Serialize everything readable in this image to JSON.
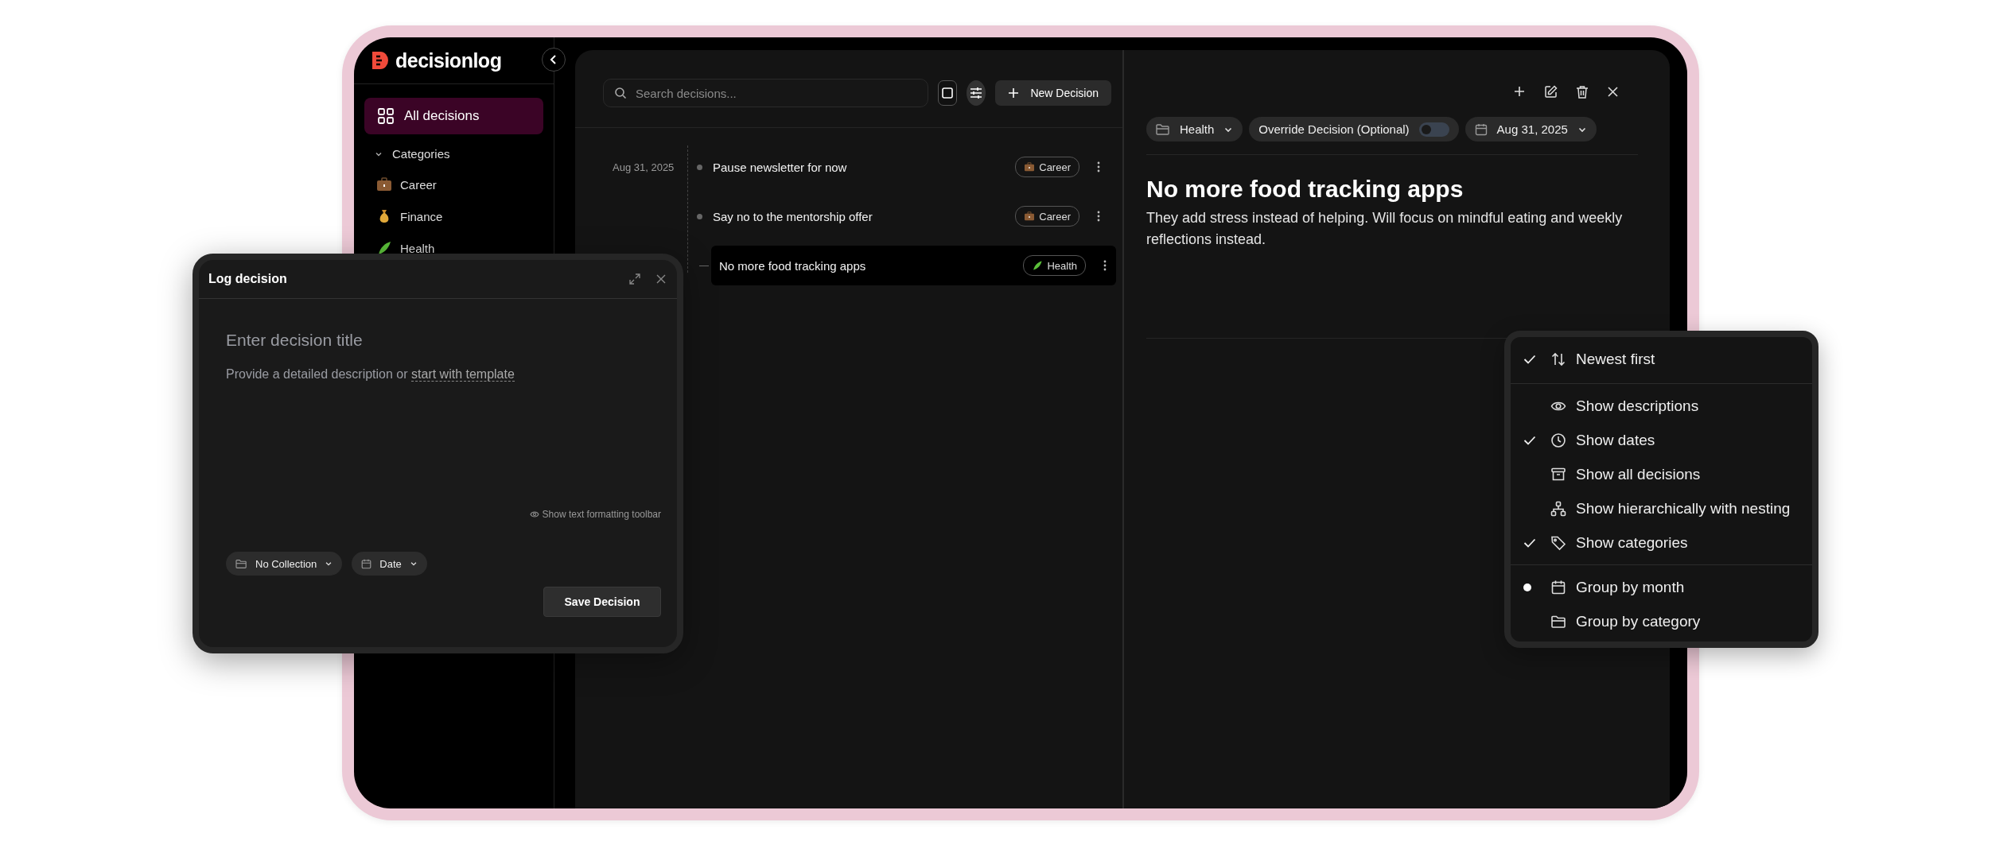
{
  "sidebar": {
    "logo": "decisionlog",
    "nav": [
      {
        "label": "All decisions",
        "selected": true
      }
    ],
    "categories_header": {
      "label": "Categories",
      "expanded": true
    },
    "categories": [
      {
        "label": "Career",
        "kind": "briefcase"
      },
      {
        "label": "Finance",
        "kind": "moneybag"
      },
      {
        "label": "Health",
        "kind": "leaf"
      }
    ]
  },
  "list": {
    "search": {
      "placeholder": "Search decisions..."
    },
    "new_button": "New Decision",
    "items": [
      {
        "date": "Aug 31, 2025",
        "title": "Pause newsletter for now",
        "tag": {
          "label": "Career",
          "kind": "briefcase"
        },
        "selected": false
      },
      {
        "title": "Say no to the mentorship offer",
        "tag": {
          "label": "Career",
          "kind": "briefcase"
        },
        "selected": false
      },
      {
        "title": "No more food tracking apps",
        "tag": {
          "label": "Health",
          "kind": "leaf"
        },
        "selected": true
      }
    ]
  },
  "detail": {
    "collection": "Health",
    "override": {
      "label": "Override Decision (Optional)",
      "on": false
    },
    "date": "Aug 31, 2025",
    "title": "No more food tracking apps",
    "description": "They add stress instead of helping. Will focus on mindful eating and weekly reflections instead."
  },
  "view_menu": {
    "sections": [
      [
        {
          "kind": "check",
          "label": "Newest first",
          "checked": true
        }
      ],
      [
        {
          "kind": "check",
          "label": "Show descriptions",
          "checked": false
        },
        {
          "kind": "check",
          "label": "Show dates",
          "checked": true
        },
        {
          "kind": "check",
          "label": "Show all decisions",
          "checked": false
        },
        {
          "kind": "check",
          "label": "Show hierarchically with nesting",
          "checked": false
        },
        {
          "kind": "check",
          "label": "Show categories",
          "checked": true
        }
      ],
      [
        {
          "kind": "radio",
          "label": "Group by month",
          "checked": true
        },
        {
          "kind": "radio",
          "label": "Group by category",
          "checked": false
        }
      ]
    ]
  },
  "log_dialog": {
    "title": "Log decision",
    "title_placeholder": "Enter decision title",
    "description_prefix": "Provide a detailed description or",
    "template_link": "start with template",
    "toolbar_toggle": "Show text formatting toolbar",
    "collection": "No Collection",
    "date": "Date",
    "save_button": "Save Decision"
  }
}
